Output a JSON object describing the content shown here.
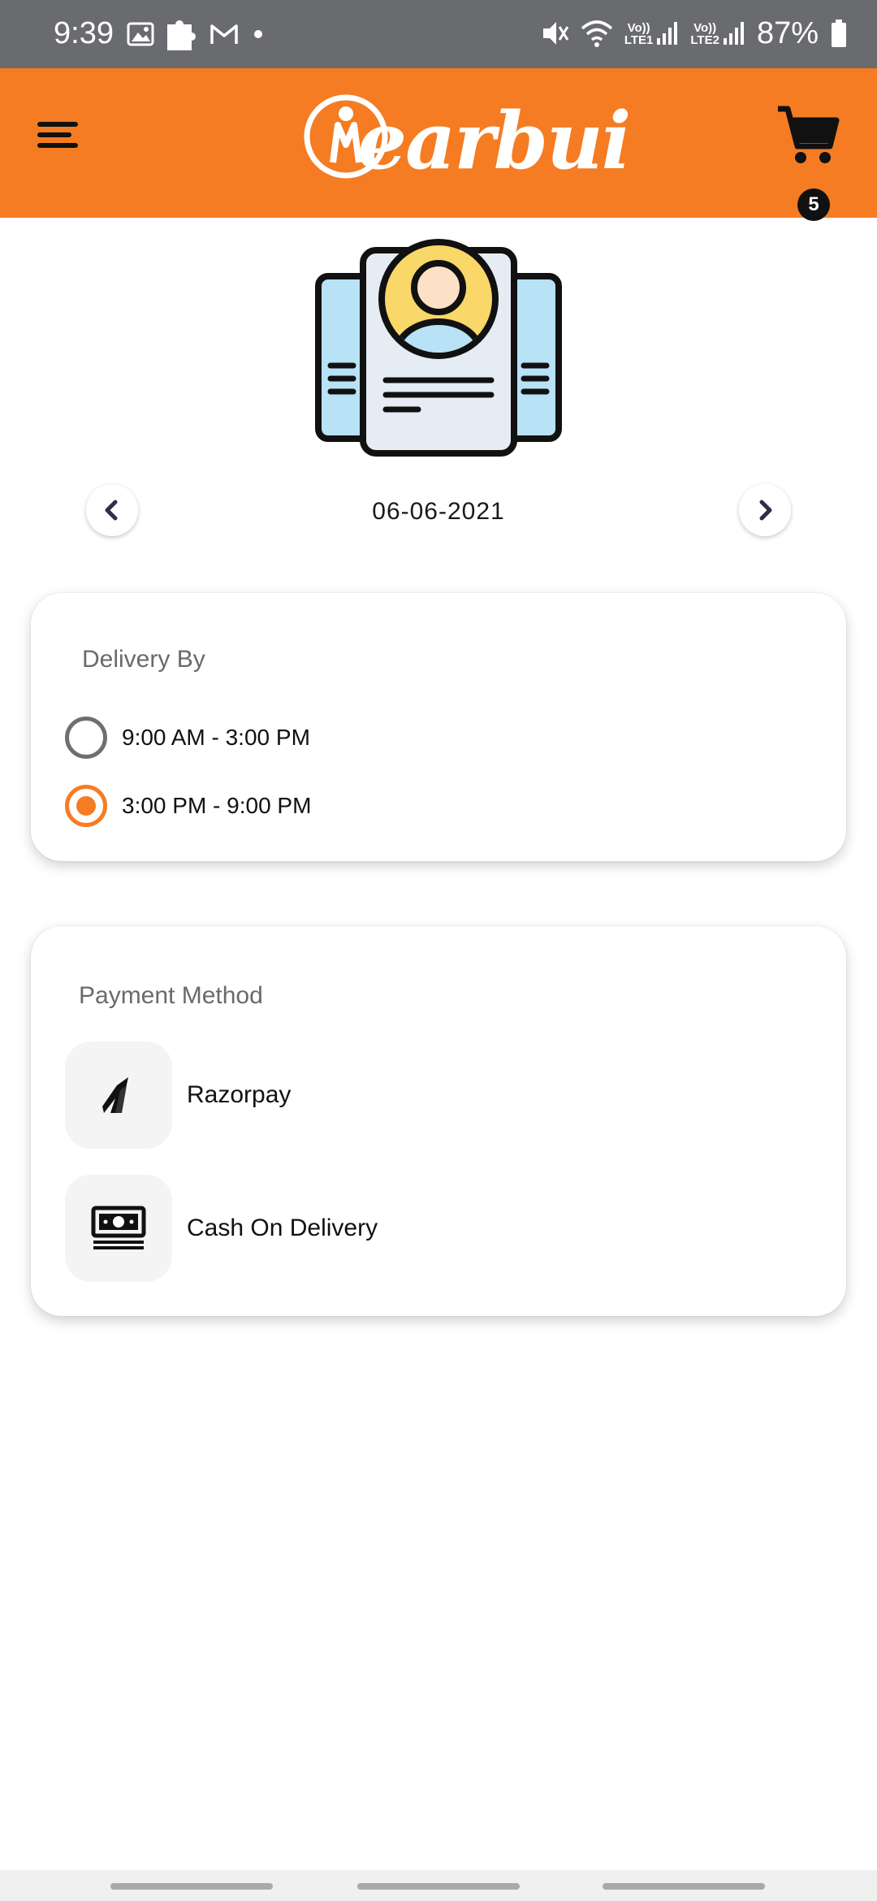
{
  "status_bar": {
    "time": "9:39",
    "battery": "87%",
    "sim1": "LTE1",
    "sim2": "LTE2",
    "volte": "Vo))",
    "icons": [
      "gallery-icon",
      "puzzle-icon",
      "gmail-icon",
      "dot-icon",
      "mute-icon",
      "wifi-icon",
      "signal-icon",
      "battery-icon"
    ]
  },
  "header": {
    "brand": "earbui",
    "cart_count": "5",
    "icons": [
      "menu-icon",
      "cart-icon"
    ],
    "color": "#f57c22"
  },
  "date_nav": {
    "date": "06-06-2021",
    "icons": [
      "chevron-left-icon",
      "chevron-right-icon"
    ]
  },
  "delivery": {
    "title": "Delivery By",
    "options": [
      {
        "label": "9:00 AM - 3:00 PM",
        "selected": false
      },
      {
        "label": "3:00 PM - 9:00 PM",
        "selected": true
      }
    ]
  },
  "payment": {
    "title": "Payment Method",
    "methods": [
      {
        "label": "Razorpay",
        "icon": "razorpay-icon"
      },
      {
        "label": "Cash On Delivery",
        "icon": "cash-icon"
      }
    ]
  },
  "colors": {
    "accent": "#f57c22",
    "status_bar": "#6a6b6f"
  }
}
